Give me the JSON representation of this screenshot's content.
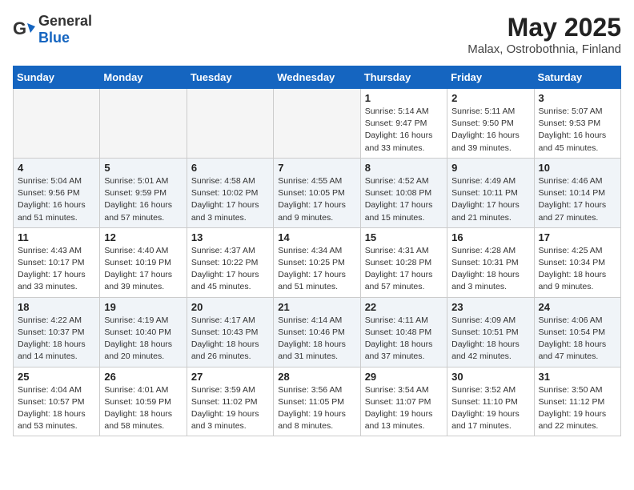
{
  "header": {
    "logo_general": "General",
    "logo_blue": "Blue",
    "title": "May 2025",
    "location": "Malax, Ostrobothnia, Finland"
  },
  "days_of_week": [
    "Sunday",
    "Monday",
    "Tuesday",
    "Wednesday",
    "Thursday",
    "Friday",
    "Saturday"
  ],
  "weeks": [
    [
      {
        "day": "",
        "empty": true
      },
      {
        "day": "",
        "empty": true
      },
      {
        "day": "",
        "empty": true
      },
      {
        "day": "",
        "empty": true
      },
      {
        "day": "1",
        "sunrise": "5:14 AM",
        "sunset": "9:47 PM",
        "daylight": "16 hours and 33 minutes."
      },
      {
        "day": "2",
        "sunrise": "5:11 AM",
        "sunset": "9:50 PM",
        "daylight": "16 hours and 39 minutes."
      },
      {
        "day": "3",
        "sunrise": "5:07 AM",
        "sunset": "9:53 PM",
        "daylight": "16 hours and 45 minutes."
      }
    ],
    [
      {
        "day": "4",
        "sunrise": "5:04 AM",
        "sunset": "9:56 PM",
        "daylight": "16 hours and 51 minutes."
      },
      {
        "day": "5",
        "sunrise": "5:01 AM",
        "sunset": "9:59 PM",
        "daylight": "16 hours and 57 minutes."
      },
      {
        "day": "6",
        "sunrise": "4:58 AM",
        "sunset": "10:02 PM",
        "daylight": "17 hours and 3 minutes."
      },
      {
        "day": "7",
        "sunrise": "4:55 AM",
        "sunset": "10:05 PM",
        "daylight": "17 hours and 9 minutes."
      },
      {
        "day": "8",
        "sunrise": "4:52 AM",
        "sunset": "10:08 PM",
        "daylight": "17 hours and 15 minutes."
      },
      {
        "day": "9",
        "sunrise": "4:49 AM",
        "sunset": "10:11 PM",
        "daylight": "17 hours and 21 minutes."
      },
      {
        "day": "10",
        "sunrise": "4:46 AM",
        "sunset": "10:14 PM",
        "daylight": "17 hours and 27 minutes."
      }
    ],
    [
      {
        "day": "11",
        "sunrise": "4:43 AM",
        "sunset": "10:17 PM",
        "daylight": "17 hours and 33 minutes."
      },
      {
        "day": "12",
        "sunrise": "4:40 AM",
        "sunset": "10:19 PM",
        "daylight": "17 hours and 39 minutes."
      },
      {
        "day": "13",
        "sunrise": "4:37 AM",
        "sunset": "10:22 PM",
        "daylight": "17 hours and 45 minutes."
      },
      {
        "day": "14",
        "sunrise": "4:34 AM",
        "sunset": "10:25 PM",
        "daylight": "17 hours and 51 minutes."
      },
      {
        "day": "15",
        "sunrise": "4:31 AM",
        "sunset": "10:28 PM",
        "daylight": "17 hours and 57 minutes."
      },
      {
        "day": "16",
        "sunrise": "4:28 AM",
        "sunset": "10:31 PM",
        "daylight": "18 hours and 3 minutes."
      },
      {
        "day": "17",
        "sunrise": "4:25 AM",
        "sunset": "10:34 PM",
        "daylight": "18 hours and 9 minutes."
      }
    ],
    [
      {
        "day": "18",
        "sunrise": "4:22 AM",
        "sunset": "10:37 PM",
        "daylight": "18 hours and 14 minutes."
      },
      {
        "day": "19",
        "sunrise": "4:19 AM",
        "sunset": "10:40 PM",
        "daylight": "18 hours and 20 minutes."
      },
      {
        "day": "20",
        "sunrise": "4:17 AM",
        "sunset": "10:43 PM",
        "daylight": "18 hours and 26 minutes."
      },
      {
        "day": "21",
        "sunrise": "4:14 AM",
        "sunset": "10:46 PM",
        "daylight": "18 hours and 31 minutes."
      },
      {
        "day": "22",
        "sunrise": "4:11 AM",
        "sunset": "10:48 PM",
        "daylight": "18 hours and 37 minutes."
      },
      {
        "day": "23",
        "sunrise": "4:09 AM",
        "sunset": "10:51 PM",
        "daylight": "18 hours and 42 minutes."
      },
      {
        "day": "24",
        "sunrise": "4:06 AM",
        "sunset": "10:54 PM",
        "daylight": "18 hours and 47 minutes."
      }
    ],
    [
      {
        "day": "25",
        "sunrise": "4:04 AM",
        "sunset": "10:57 PM",
        "daylight": "18 hours and 53 minutes."
      },
      {
        "day": "26",
        "sunrise": "4:01 AM",
        "sunset": "10:59 PM",
        "daylight": "18 hours and 58 minutes."
      },
      {
        "day": "27",
        "sunrise": "3:59 AM",
        "sunset": "11:02 PM",
        "daylight": "19 hours and 3 minutes."
      },
      {
        "day": "28",
        "sunrise": "3:56 AM",
        "sunset": "11:05 PM",
        "daylight": "19 hours and 8 minutes."
      },
      {
        "day": "29",
        "sunrise": "3:54 AM",
        "sunset": "11:07 PM",
        "daylight": "19 hours and 13 minutes."
      },
      {
        "day": "30",
        "sunrise": "3:52 AM",
        "sunset": "11:10 PM",
        "daylight": "19 hours and 17 minutes."
      },
      {
        "day": "31",
        "sunrise": "3:50 AM",
        "sunset": "11:12 PM",
        "daylight": "19 hours and 22 minutes."
      }
    ]
  ],
  "labels": {
    "sunrise": "Sunrise:",
    "sunset": "Sunset:",
    "daylight": "Daylight:"
  }
}
